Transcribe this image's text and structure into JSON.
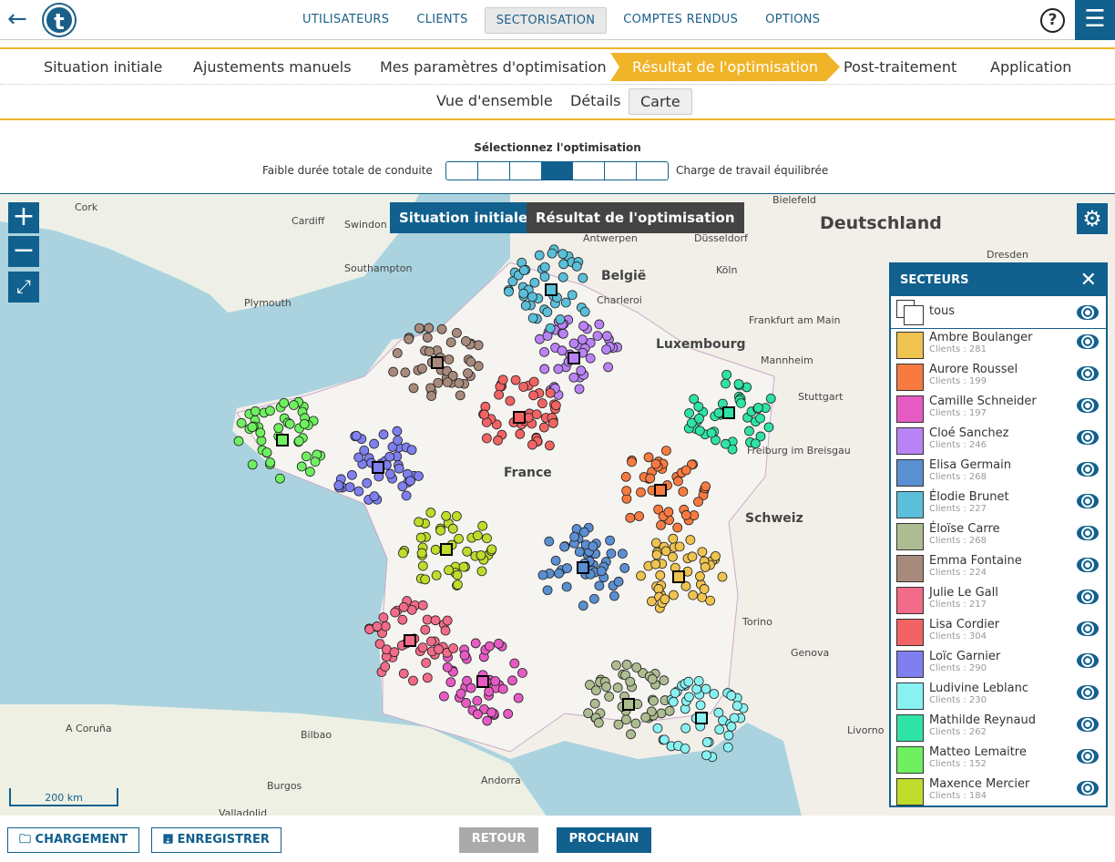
{
  "header": {
    "nav": [
      "UTILISATEURS",
      "CLIENTS",
      "SECTORISATION",
      "COMPTES RENDUS",
      "OPTIONS"
    ],
    "active_nav": "SECTORISATION",
    "help": "?",
    "logo": "t"
  },
  "steps": [
    "Situation initiale",
    "Ajustements manuels",
    "Mes paramètres d'optimisation",
    "Résultat de l'optimisation",
    "Post-traitement",
    "Application"
  ],
  "active_step": "Résultat de l'optimisation",
  "subtabs": [
    "Vue d'ensemble",
    "Détails",
    "Carte"
  ],
  "active_subtab": "Carte",
  "optimisation": {
    "title": "Sélectionnez l'optimisation",
    "left_label": "Faible durée totale de conduite",
    "right_label": "Charge de travail équilibrée",
    "steps": 7,
    "selected": 4
  },
  "map": {
    "tab_initial": "Situation initiale",
    "tab_result": "Résultat de l'optimisation",
    "scale": "200 km",
    "labels": [
      [
        "Cork",
        82,
        8
      ],
      [
        "Cardiff",
        320,
        23
      ],
      [
        "Swindon",
        378,
        27
      ],
      [
        "Southampton",
        378,
        75
      ],
      [
        "Plymouth",
        268,
        113
      ],
      [
        "Antwerpen",
        640,
        42
      ],
      [
        "Düsseldorf",
        762,
        42
      ],
      [
        "België",
        660,
        82
      ],
      [
        "Charleroi",
        655,
        110
      ],
      [
        "Köln",
        786,
        77
      ],
      [
        "Luxembourg",
        720,
        157
      ],
      [
        "Frankfurt am Main",
        822,
        132
      ],
      [
        "Mannheim",
        835,
        176
      ],
      [
        "Stuttgart",
        876,
        216
      ],
      [
        "Dresden",
        1083,
        60
      ],
      [
        "Bielefeld",
        848,
        0
      ],
      [
        "Freiburg im Breisgau",
        820,
        275
      ],
      [
        "Schweiz",
        818,
        348
      ],
      [
        "Torino",
        815,
        463
      ],
      [
        "Genova",
        868,
        497
      ],
      [
        "Livorno",
        930,
        582
      ],
      [
        "Bilbao",
        330,
        587
      ],
      [
        "A Coruña",
        72,
        580
      ],
      [
        "Burgos",
        293,
        643
      ],
      [
        "Andorra",
        528,
        637
      ],
      [
        "Valladolid",
        240,
        673
      ],
      [
        "France",
        553,
        298
      ],
      [
        "Deutschland",
        900,
        21
      ]
    ]
  },
  "sectors": {
    "title": "SECTEURS",
    "all_label": "tous",
    "items": [
      {
        "name": "Ambre Boulanger",
        "clients": "Clients : 281",
        "color": "#efc34f"
      },
      {
        "name": "Aurore Roussel",
        "clients": "Clients : 199",
        "color": "#f77a40"
      },
      {
        "name": "Camille Schneider",
        "clients": "Clients : 197",
        "color": "#e55bc3"
      },
      {
        "name": "Cloé Sanchez",
        "clients": "Clients : 246",
        "color": "#b983f5"
      },
      {
        "name": "Elisa Germain",
        "clients": "Clients : 268",
        "color": "#5a8fd1"
      },
      {
        "name": "Élodie Brunet",
        "clients": "Clients : 227",
        "color": "#5bbfd9"
      },
      {
        "name": "Éloïse Carre",
        "clients": "Clients : 268",
        "color": "#adbd91"
      },
      {
        "name": "Emma Fontaine",
        "clients": "Clients : 224",
        "color": "#a88a7c"
      },
      {
        "name": "Julie Le Gall",
        "clients": "Clients : 217",
        "color": "#f26b88"
      },
      {
        "name": "Lisa Cordier",
        "clients": "Clients : 304",
        "color": "#f26464"
      },
      {
        "name": "Loïc Garnier",
        "clients": "Clients : 290",
        "color": "#7f7ff0"
      },
      {
        "name": "Ludivine Leblanc",
        "clients": "Clients : 230",
        "color": "#88f2f2"
      },
      {
        "name": "Mathilde Reynaud",
        "clients": "Clients : 262",
        "color": "#2ee3a5"
      },
      {
        "name": "Matteo Lemaitre",
        "clients": "Clients : 152",
        "color": "#6ef060"
      },
      {
        "name": "Maxence Mercier",
        "clients": "Clients : 184",
        "color": "#bedc2a"
      }
    ]
  },
  "footer": {
    "load": "CHARGEMENT",
    "save": "ENREGISTRER",
    "back": "RETOUR",
    "next": "PROCHAIN"
  }
}
